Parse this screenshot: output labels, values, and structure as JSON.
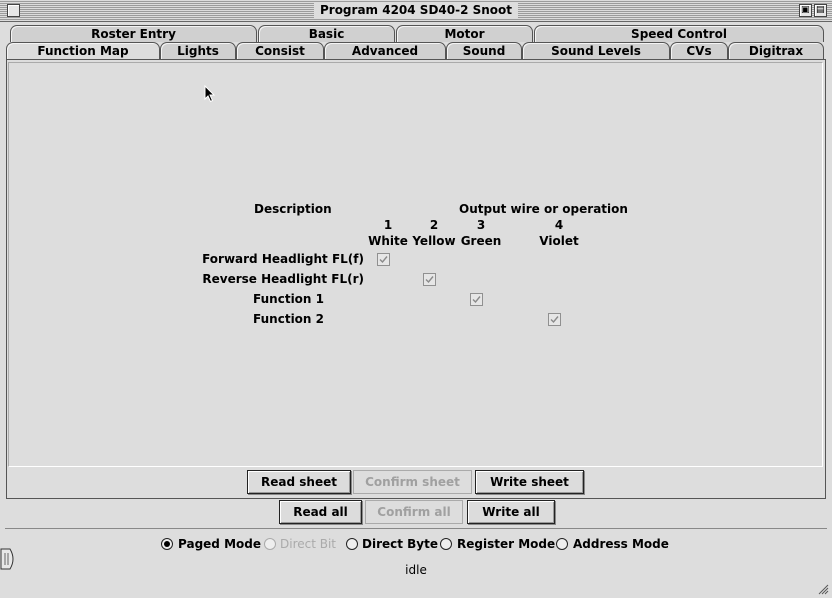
{
  "window": {
    "title": "Program 4204  SD40-2 Snoot"
  },
  "tabs_back": [
    {
      "label": "Roster Entry"
    },
    {
      "label": "Basic"
    },
    {
      "label": "Motor"
    },
    {
      "label": "Speed Control"
    }
  ],
  "tabs_front": [
    {
      "label": "Function Map",
      "active": true
    },
    {
      "label": "Lights"
    },
    {
      "label": "Consist"
    },
    {
      "label": "Advanced"
    },
    {
      "label": "Sound"
    },
    {
      "label": "Sound Levels"
    },
    {
      "label": "CVs"
    },
    {
      "label": "Digitrax"
    }
  ],
  "function_map": {
    "description_header": "Description",
    "output_header": "Output wire or operation",
    "columns": [
      {
        "number": "1",
        "color": "White"
      },
      {
        "number": "2",
        "color": "Yellow"
      },
      {
        "number": "3",
        "color": "Green"
      },
      {
        "number": "4",
        "color": "Violet"
      }
    ],
    "rows": [
      {
        "label": "Forward Headlight FL(f)",
        "checked_column": 1
      },
      {
        "label": "Reverse Headlight FL(r)",
        "checked_column": 2
      },
      {
        "label": "Function 1",
        "checked_column": 3
      },
      {
        "label": "Function 2",
        "checked_column": 4
      }
    ]
  },
  "sheet_buttons": {
    "read": "Read sheet",
    "confirm": "Confirm sheet",
    "write": "Write sheet"
  },
  "all_buttons": {
    "read": "Read all",
    "confirm": "Confirm all",
    "write": "Write all"
  },
  "modes": [
    {
      "label": "Paged Mode",
      "selected": true,
      "enabled": true
    },
    {
      "label": "Direct Bit",
      "selected": false,
      "enabled": false
    },
    {
      "label": "Direct Byte",
      "selected": false,
      "enabled": true
    },
    {
      "label": "Register Mode",
      "selected": false,
      "enabled": true
    },
    {
      "label": "Address Mode",
      "selected": false,
      "enabled": true
    }
  ],
  "status": "idle",
  "icons": {
    "close_box": "close-box-icon",
    "zoom_box": "zoom-box-icon",
    "collapse_box": "collapse-box-icon",
    "grow_box": "grow-box-icon",
    "pointer": "arrow-cursor-icon",
    "side_handle": "drawer-handle-icon"
  }
}
